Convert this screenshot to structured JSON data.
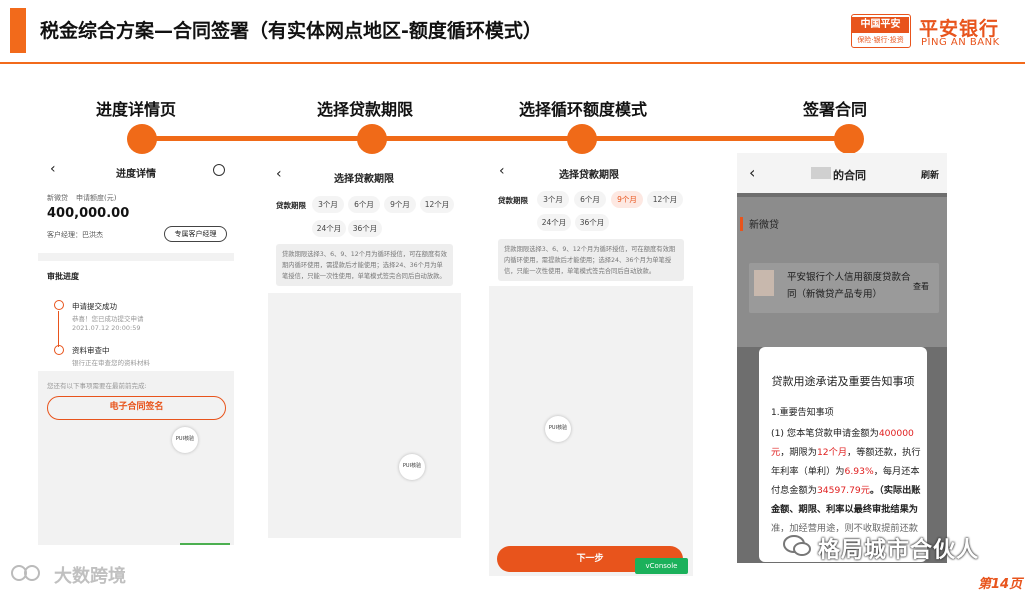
{
  "header": {
    "title": "税金综合方案—合同签署（有实体网点地区-额度循环模式）",
    "logo_box_top": "中国平安",
    "logo_box_bottom": "保险·银行·投资",
    "bank_cn": "平安银行",
    "bank_en": "PING AN BANK"
  },
  "steps": [
    {
      "label": "进度详情页"
    },
    {
      "label": "选择贷款期限"
    },
    {
      "label": "选择循环额度模式"
    },
    {
      "label": "签署合同"
    }
  ],
  "phone1": {
    "title": "进度详情",
    "product_label": "新微贷",
    "amount_label": "申请额度(元)",
    "amount": "400,000.00",
    "manager_label": "客户经理：巴洪杰",
    "manager_button": "专属客户经理",
    "section": "审批进度",
    "step1_title": "申请提交成功",
    "step1_desc": "恭喜！您已成功提交申请",
    "step1_time": "2021.07.12 20:00:59",
    "step2_title": "资料审查中",
    "step2_desc": "银行正在审查您的资料材料",
    "hint": "您还有以下事项需要在最前前完成:",
    "sign_button": "电子合同签名",
    "pui": "PUI核验"
  },
  "phone2": {
    "title": "选择贷款期限",
    "term_label": "贷款期限",
    "options": [
      "3个月",
      "6个月",
      "9个月",
      "12个月",
      "24个月",
      "36个月"
    ],
    "note": "贷款期限选择3、6、9、12个月为循环授信，可在额度有效期内循环使用，需提款后才能使用；选择24、36个月为单笔授信，只能一次性使用，单笔模式签完合同后自动放款。",
    "pui": "PUI核验"
  },
  "phone3": {
    "title": "选择贷款期限",
    "term_label": "贷款期限",
    "options": [
      "3个月",
      "6个月",
      "9个月",
      "12个月",
      "24个月",
      "36个月"
    ],
    "selected": "9个月",
    "note": "贷款期限选择3、6、9、12个月为循环授信，可在额度有效期内循环使用，需提款后才能使用；选择24、36个月为单笔授信，只能一次性使用，单笔模式签完合同后自动放款。",
    "pui": "PUI核验",
    "next_button": "下一步",
    "console": "vConsole"
  },
  "phone4": {
    "title": "的合同",
    "refresh": "刷新",
    "product": "新微贷",
    "contract_name": "平安银行个人信用额度贷款合同（新微贷产品专用）",
    "view": "查看",
    "modal_title": "贷款用途承诺及重要告知事项",
    "modal_h1": "1.重要告知事项",
    "modal_p1_a": "(1) 您本笔贷款申请金额为",
    "modal_amount": "400000元",
    "modal_p1_b": "，期限为",
    "modal_term": "12个月",
    "modal_p1_c": "，等额还款，执行年利率（单利）为",
    "modal_rate": "6.93%",
    "modal_p1_d": "，每月还本付息金额为",
    "modal_pay": "34597.79元",
    "modal_p1_e": "。（实际出账金额、期限、利率以最终审批结果为",
    "modal_p1_f": "准，加经营用途，则不收取提前还款"
  },
  "footer": {
    "left_brand": "大数跨境",
    "right_brand": "格局城市合伙人",
    "page": "第14页"
  },
  "colors": {
    "accent": "#f06a18",
    "bank_red": "#e8541c",
    "warn_red": "#e02020"
  }
}
